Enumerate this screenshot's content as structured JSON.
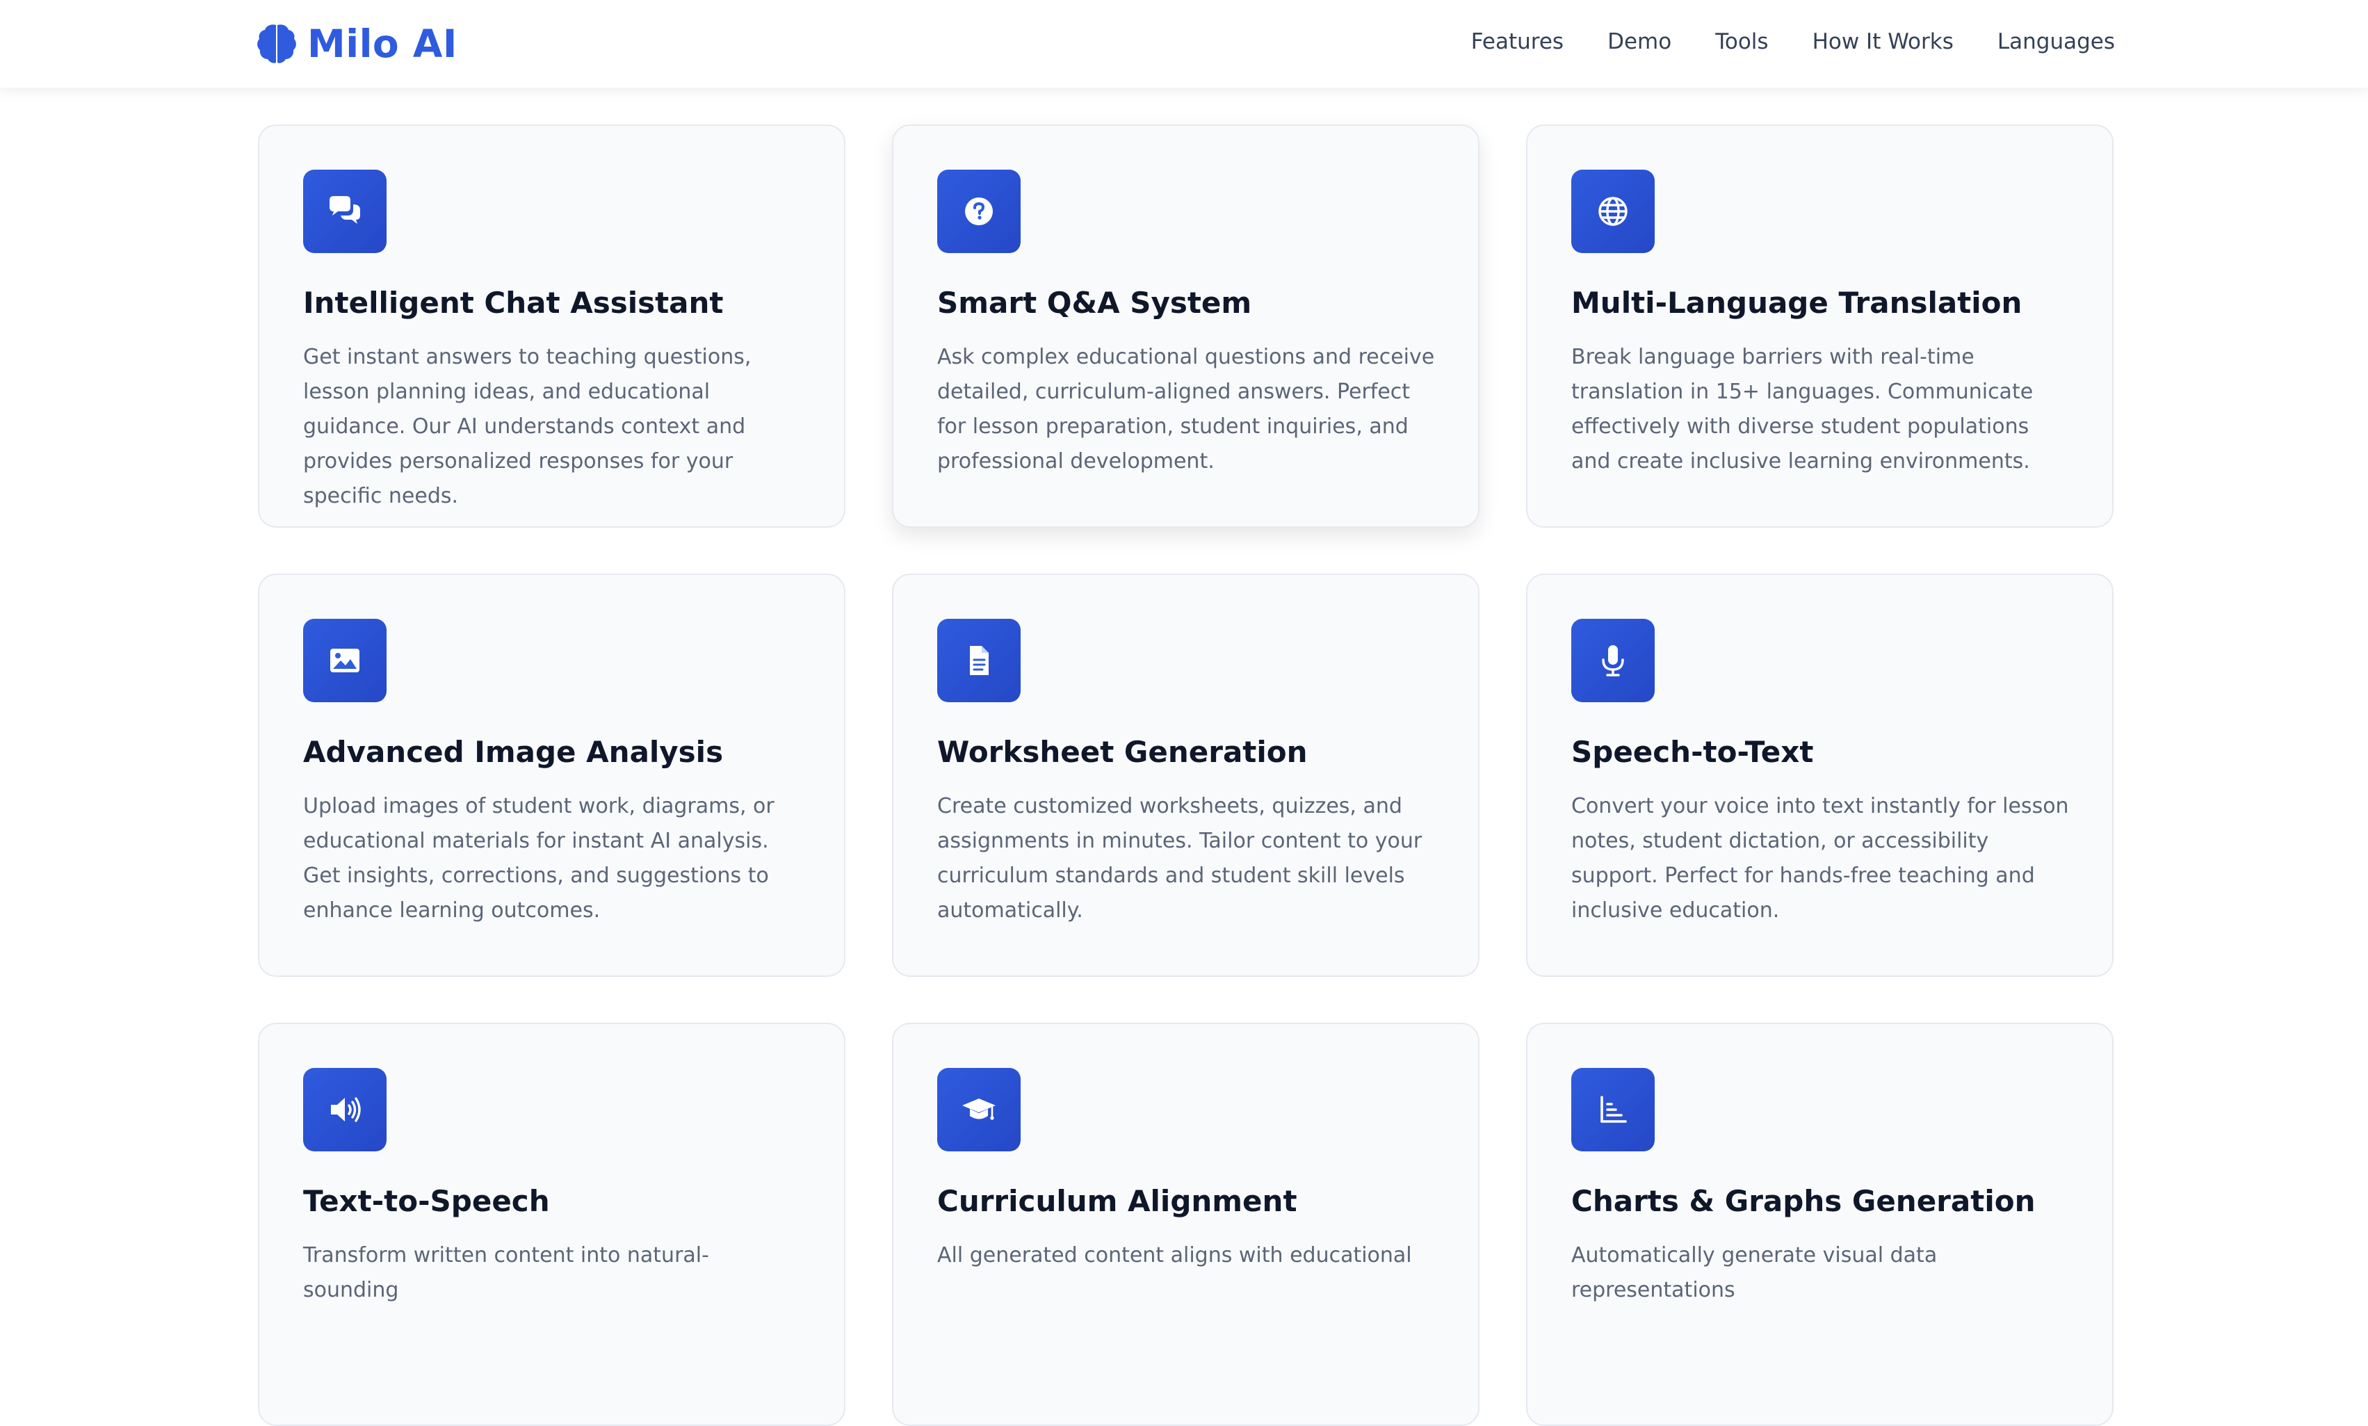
{
  "brand": {
    "name": "Milo AI",
    "color": "#2f5bde"
  },
  "nav": {
    "items": [
      "Features",
      "Demo",
      "Tools",
      "How It Works",
      "Languages"
    ]
  },
  "features": [
    {
      "icon": "chat-bubbles-icon",
      "title": "Intelligent Chat Assistant",
      "desc": "Get instant answers to teaching questions, lesson planning ideas, and educational guidance. Our AI understands context and provides personalized responses for your specific needs."
    },
    {
      "icon": "question-circle-icon",
      "title": "Smart Q&A System",
      "desc": "Ask complex educational questions and receive detailed, curriculum-aligned answers. Perfect for lesson preparation, student inquiries, and professional development."
    },
    {
      "icon": "globe-icon",
      "title": "Multi-Language Translation",
      "desc": "Break language barriers with real-time translation in 15+ languages. Communicate effectively with diverse student populations and create inclusive learning environments."
    },
    {
      "icon": "image-icon",
      "title": "Advanced Image Analysis",
      "desc": "Upload images of student work, diagrams, or educational materials for instant AI analysis. Get insights, corrections, and suggestions to enhance learning outcomes."
    },
    {
      "icon": "document-icon",
      "title": "Worksheet Generation",
      "desc": "Create customized worksheets, quizzes, and assignments in minutes. Tailor content to your curriculum standards and student skill levels automatically."
    },
    {
      "icon": "microphone-icon",
      "title": "Speech-to-Text",
      "desc": "Convert your voice into text instantly for lesson notes, student dictation, or accessibility support. Perfect for hands-free teaching and inclusive education."
    },
    {
      "icon": "speaker-icon",
      "title": "Text-to-Speech",
      "desc": "Transform written content into natural-sounding"
    },
    {
      "icon": "graduation-cap-icon",
      "title": "Curriculum Alignment",
      "desc": "All generated content aligns with educational"
    },
    {
      "icon": "chart-icon",
      "title": "Charts & Graphs Generation",
      "desc": "Automatically generate visual data representations"
    }
  ]
}
